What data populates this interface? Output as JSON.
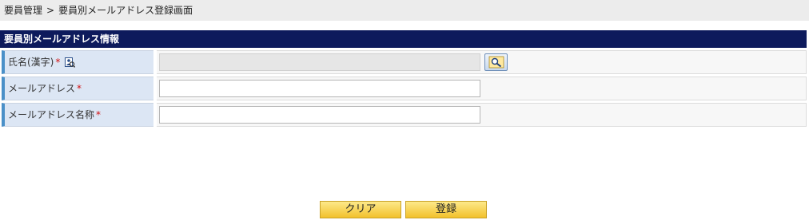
{
  "breadcrumb": {
    "parent": "要員管理",
    "separator": ">",
    "current": "要員別メールアドレス登録画面"
  },
  "section": {
    "title": "要員別メールアドレス情報"
  },
  "form": {
    "fields": [
      {
        "label": "氏名(漢字)",
        "required_mark": "*",
        "value": ""
      },
      {
        "label": "メールアドレス",
        "required_mark": "*",
        "value": ""
      },
      {
        "label": "メールアドレス名称",
        "required_mark": "*",
        "value": ""
      }
    ]
  },
  "icons": {
    "name_lookup": "person-search-icon",
    "lookup_button": "search-wrench-icon"
  },
  "buttons": {
    "clear": "クリア",
    "register": "登録"
  },
  "colors": {
    "header_bg": "#0d1a5c",
    "label_bg": "#dce6f4",
    "label_accent": "#4a90c8",
    "required": "#d21010",
    "button_bg": "#f2c12c"
  }
}
